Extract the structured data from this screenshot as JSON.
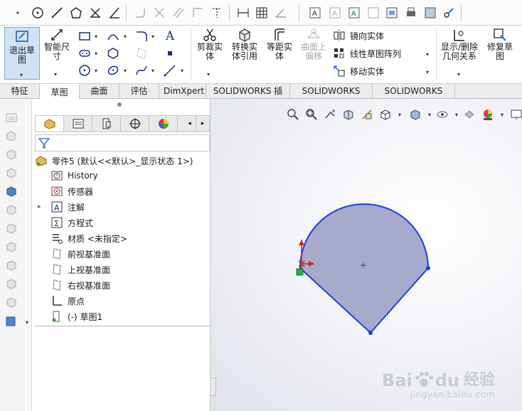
{
  "command_manager": {
    "exit_sketch": "退出草图",
    "smart_dim_1": "智能尺",
    "smart_dim_2": "寸",
    "trim_1": "剪裁实",
    "trim_2": "体",
    "convert_1": "转换实",
    "convert_2": "体引用",
    "offset_1": "等距实",
    "offset_2": "体",
    "surface_offset_1": "曲面上",
    "surface_offset_2": "偏移",
    "mirror": "镜向实体",
    "linear_pattern": "线性草图阵列",
    "move": "移动实体",
    "display_relations_1": "显示/删除",
    "display_relations_2": "几何关系",
    "repair_1": "修复草",
    "repair_2": "图"
  },
  "tabs": [
    "特征",
    "草图",
    "曲面",
    "评估",
    "DimXpert",
    "SOLIDWORKS 插件",
    "SOLIDWORKS MBD",
    "SOLIDWORKS CAM"
  ],
  "active_tab": "草图",
  "feature_tree": {
    "root": "零件5  (默认<<默认>_显示状态 1>)",
    "items": [
      {
        "label": "History",
        "icon": "history-folder-icon"
      },
      {
        "label": "传感器",
        "icon": "sensor-icon"
      },
      {
        "label": "注解",
        "icon": "annotation-icon"
      },
      {
        "label": "方程式",
        "icon": "equation-icon"
      },
      {
        "label": "材质 <未指定>",
        "icon": "material-icon"
      },
      {
        "label": "前视基准面",
        "icon": "plane-icon"
      },
      {
        "label": "上视基准面",
        "icon": "plane-icon"
      },
      {
        "label": "右视基准面",
        "icon": "plane-icon"
      },
      {
        "label": "原点",
        "icon": "origin-icon"
      },
      {
        "label": "(-) 草图1",
        "icon": "sketch-icon"
      }
    ]
  },
  "watermark": {
    "brand": "Bai",
    "brand2": "du",
    "jingyan": "经验",
    "url": "jingyan.baidu.com"
  },
  "colors": {
    "accent": "#2060d0",
    "sketch_fill": "#a8aacb",
    "sketch_stroke": "#1a3fe6"
  }
}
